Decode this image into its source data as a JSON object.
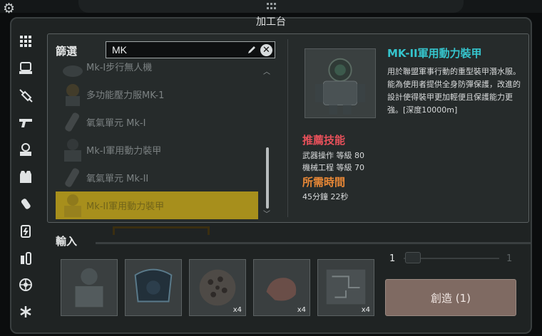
{
  "window": {
    "title": "加工台"
  },
  "filter": {
    "label": "篩選",
    "search_value": "MK"
  },
  "list": {
    "items": [
      {
        "label": "Mk-I步行無人機"
      },
      {
        "label": "多功能壓力服MK-1"
      },
      {
        "label": "氧氣單元 Mk-I"
      },
      {
        "label": "Mk-I軍用動力裝甲"
      },
      {
        "label": "氧氣單元 Mk-II"
      },
      {
        "label": "Mk-II軍用動力裝甲",
        "selected": true
      }
    ]
  },
  "detail": {
    "name": "MK-II軍用動力裝甲",
    "description": "用於聯盟軍事行動的重型裝甲潛水服。能為使用者提供全身防彈保護，改進的設計使得裝甲更加輕便且保護能力更強。[深度10000m]",
    "skills_heading": "推薦技能",
    "skills": [
      {
        "text": "武器操作 等級 80"
      },
      {
        "text": "機械工程 等級 70"
      }
    ],
    "time_heading": "所需時間",
    "time_value": "45分鐘 22秒"
  },
  "inputs": {
    "label": "輸入",
    "slots": [
      {
        "count": "",
        "icon": "power-armor-icon"
      },
      {
        "count": "",
        "icon": "armor-suit-icon"
      },
      {
        "count": "x4",
        "icon": "ore-icon"
      },
      {
        "count": "x4",
        "icon": "rock-icon"
      },
      {
        "count": "x4",
        "icon": "circuit-board-icon"
      }
    ]
  },
  "quantity": {
    "min": "1",
    "max": "1"
  },
  "create_button": {
    "label": "創造 (1)"
  },
  "colors": {
    "accent_name": "#35c4cc",
    "skills_heading": "#e6505a",
    "time_heading": "#e98836",
    "selection": "#a78f1c"
  }
}
